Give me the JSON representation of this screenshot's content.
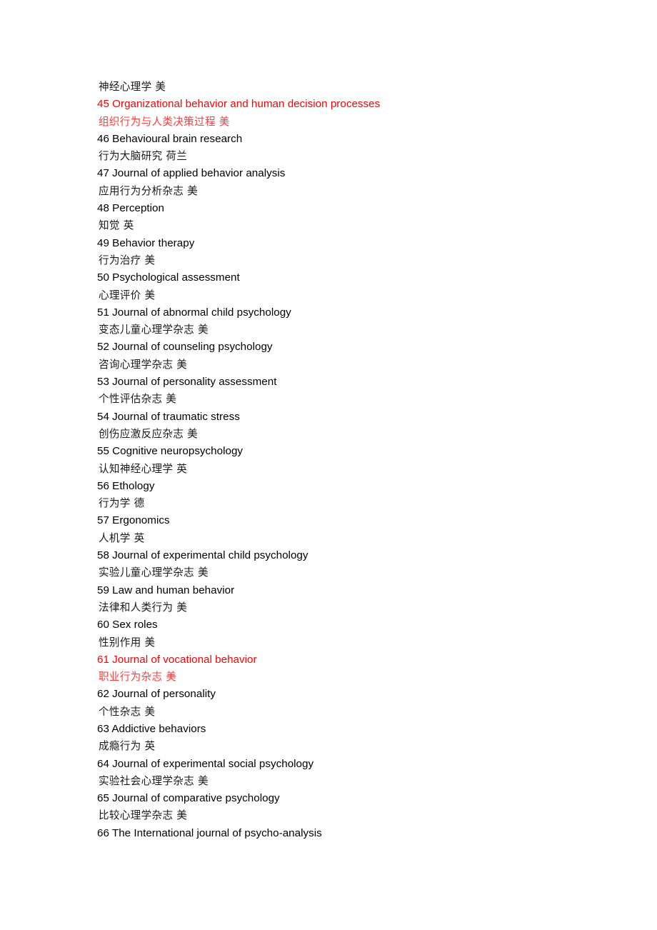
{
  "document": {
    "type": "journal-list",
    "language": "en-zh",
    "background_color": "#ffffff",
    "text_color": "#000000",
    "highlight_color": "#ff0000",
    "leading_line": {
      "zh": "神经心理学 美"
    },
    "entries": [
      {
        "number": "45",
        "en": "45 Organizational behavior and human decision processes",
        "zh": "组织行为与人类决策过程 美",
        "highlight": true
      },
      {
        "number": "46",
        "en": "46 Behavioural brain research",
        "zh": "行为大脑研究 荷兰",
        "highlight": false
      },
      {
        "number": "47",
        "en": "47 Journal of applied behavior analysis",
        "zh": "应用行为分析杂志 美",
        "highlight": false
      },
      {
        "number": "48",
        "en": "48 Perception",
        "zh": "知觉 英",
        "highlight": false
      },
      {
        "number": "49",
        "en": "49 Behavior therapy",
        "zh": "行为治疗 美",
        "highlight": false
      },
      {
        "number": "50",
        "en": "50 Psychological assessment",
        "zh": "心理评价 美",
        "highlight": false
      },
      {
        "number": "51",
        "en": "51 Journal of abnormal child psychology",
        "zh": "变态儿童心理学杂志 美",
        "highlight": false
      },
      {
        "number": "52",
        "en": "52 Journal of counseling psychology",
        "zh": "咨询心理学杂志 美",
        "highlight": false
      },
      {
        "number": "53",
        "en": "53 Journal of personality assessment",
        "zh": "个性评估杂志 美",
        "highlight": false
      },
      {
        "number": "54",
        "en": "54 Journal of traumatic stress",
        "zh": "创伤应激反应杂志 美",
        "highlight": false
      },
      {
        "number": "55",
        "en": "55 Cognitive neuropsychology",
        "zh": "认知神经心理学 英",
        "highlight": false
      },
      {
        "number": "56",
        "en": "56 Ethology",
        "zh": "行为学 德",
        "highlight": false
      },
      {
        "number": "57",
        "en": "57 Ergonomics",
        "zh": "人机学 英",
        "highlight": false
      },
      {
        "number": "58",
        "en": "58 Journal of experimental child psychology",
        "zh": "实验儿童心理学杂志 美",
        "highlight": false
      },
      {
        "number": "59",
        "en": "59 Law and human behavior",
        "zh": "法律和人类行为 美",
        "highlight": false
      },
      {
        "number": "60",
        "en": "60 Sex roles",
        "zh": "性别作用 美",
        "highlight": false
      },
      {
        "number": "61",
        "en": "61 Journal of vocational behavior",
        "zh": "职业行为杂志 美",
        "highlight": true
      },
      {
        "number": "62",
        "en": "62 Journal of personality",
        "zh": "个性杂志 美",
        "highlight": false
      },
      {
        "number": "63",
        "en": "63 Addictive behaviors",
        "zh": "成瘾行为 英",
        "highlight": false
      },
      {
        "number": "64",
        "en": "64 Journal of experimental social psychology",
        "zh": "实验社会心理学杂志 美",
        "highlight": false
      },
      {
        "number": "65",
        "en": "65 Journal of comparative psychology",
        "zh": "比较心理学杂志 美",
        "highlight": false
      },
      {
        "number": "66",
        "en": "66 The International journal of psycho-analysis",
        "zh": "",
        "highlight": false
      }
    ]
  }
}
